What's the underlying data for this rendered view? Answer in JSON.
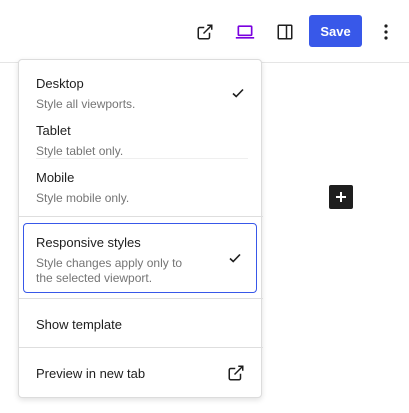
{
  "toolbar": {
    "icons": [
      "external-link-icon",
      "laptop-icon",
      "sidebar-toggle-icon",
      "more-vertical-icon"
    ],
    "save_label": "Save",
    "accent": "#3858e9",
    "active_icon_color": "#7a00df"
  },
  "menu": {
    "viewports": [
      {
        "label": "Desktop",
        "desc": "Style all viewports.",
        "checked": true
      },
      {
        "label": "Tablet",
        "desc": "Style tablet only.",
        "checked": false
      },
      {
        "label": "Mobile",
        "desc": "Style mobile only.",
        "checked": false
      }
    ],
    "responsive": {
      "label": "Responsive styles",
      "desc_line1": "Style changes apply only to",
      "desc_line2": "the selected viewport.",
      "checked": true
    },
    "show_template": "Show template",
    "preview_new_tab": "Preview in new tab"
  }
}
